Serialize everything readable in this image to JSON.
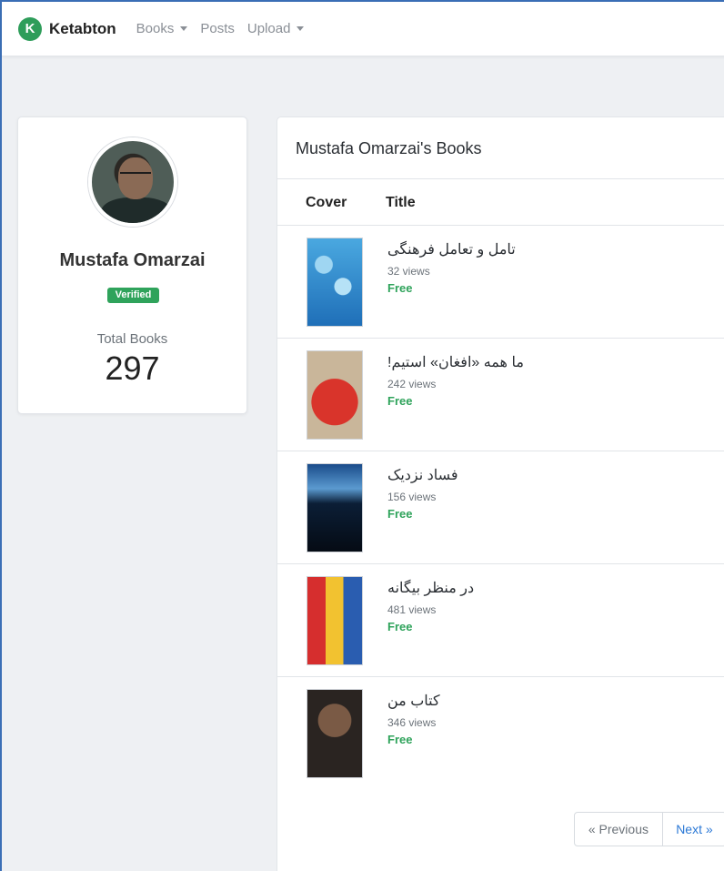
{
  "navbar": {
    "logo_letter": "K",
    "brand": "Ketabton",
    "items": [
      {
        "label": "Books",
        "has_dropdown": true
      },
      {
        "label": "Posts",
        "has_dropdown": false
      },
      {
        "label": "Upload",
        "has_dropdown": true
      }
    ]
  },
  "profile": {
    "name": "Mustafa Omarzai",
    "badge": "Verified",
    "total_label": "Total Books",
    "total_value": "297"
  },
  "books": {
    "heading": "Mustafa Omarzai's Books",
    "columns": [
      "Cover",
      "Title"
    ],
    "items": [
      {
        "title": "تامل و تعامل فرهنگی",
        "views": "32 views",
        "price": "Free"
      },
      {
        "title": "ما همه «افغان» استیم!",
        "views": "242 views",
        "price": "Free"
      },
      {
        "title": "فساد نزدیک",
        "views": "156 views",
        "price": "Free"
      },
      {
        "title": "در منظر بیگانه",
        "views": "481 views",
        "price": "Free"
      },
      {
        "title": "کتاب من",
        "views": "346 views",
        "price": "Free"
      }
    ]
  },
  "pagination": {
    "previous": "« Previous",
    "next": "Next »"
  },
  "colors": {
    "accent_green": "#2fa35b",
    "link_blue": "#2a78d6"
  }
}
